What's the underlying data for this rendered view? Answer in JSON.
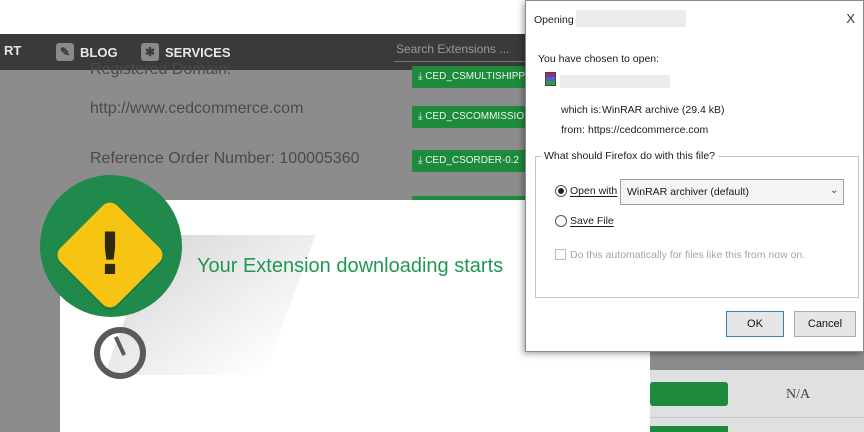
{
  "nav": {
    "partial_item": "RT",
    "blog_label": "BLOG",
    "services_label": "SERVICES",
    "search_placeholder": "Search Extensions ..."
  },
  "background": {
    "registered_domain_label": "Registered Domain:",
    "domain_url": "http://www.cedcommerce.com",
    "reference_order": "Reference Order Number: 100005360",
    "download_buttons": [
      "CED_CSMULTISHIPP",
      "CED_CSCOMMISSIO",
      "CED_CSORDER-0.2"
    ],
    "na_text": "N/A"
  },
  "modal": {
    "title": "Your Extension downloading starts"
  },
  "dialog": {
    "title_prefix": "Opening",
    "close_label": "X",
    "chosen_text": "You have chosen to open:",
    "which_is_label": "which is:",
    "which_is_value": "WinRAR archive (29.4 kB)",
    "from_label": "from:",
    "from_value": "https://cedcommerce.com",
    "question": "What should Firefox do with this file?",
    "open_with_label": "Open with",
    "open_with_app": "WinRAR archiver (default)",
    "save_file_label": "Save File",
    "auto_label": "Do this automatically for files like this from now on.",
    "ok_label": "OK",
    "cancel_label": "Cancel",
    "selected_option": "open_with"
  },
  "colors": {
    "accent_green": "#1e8a3c",
    "warning_yellow": "#f7c413",
    "navbar": "#3a3a3a"
  }
}
